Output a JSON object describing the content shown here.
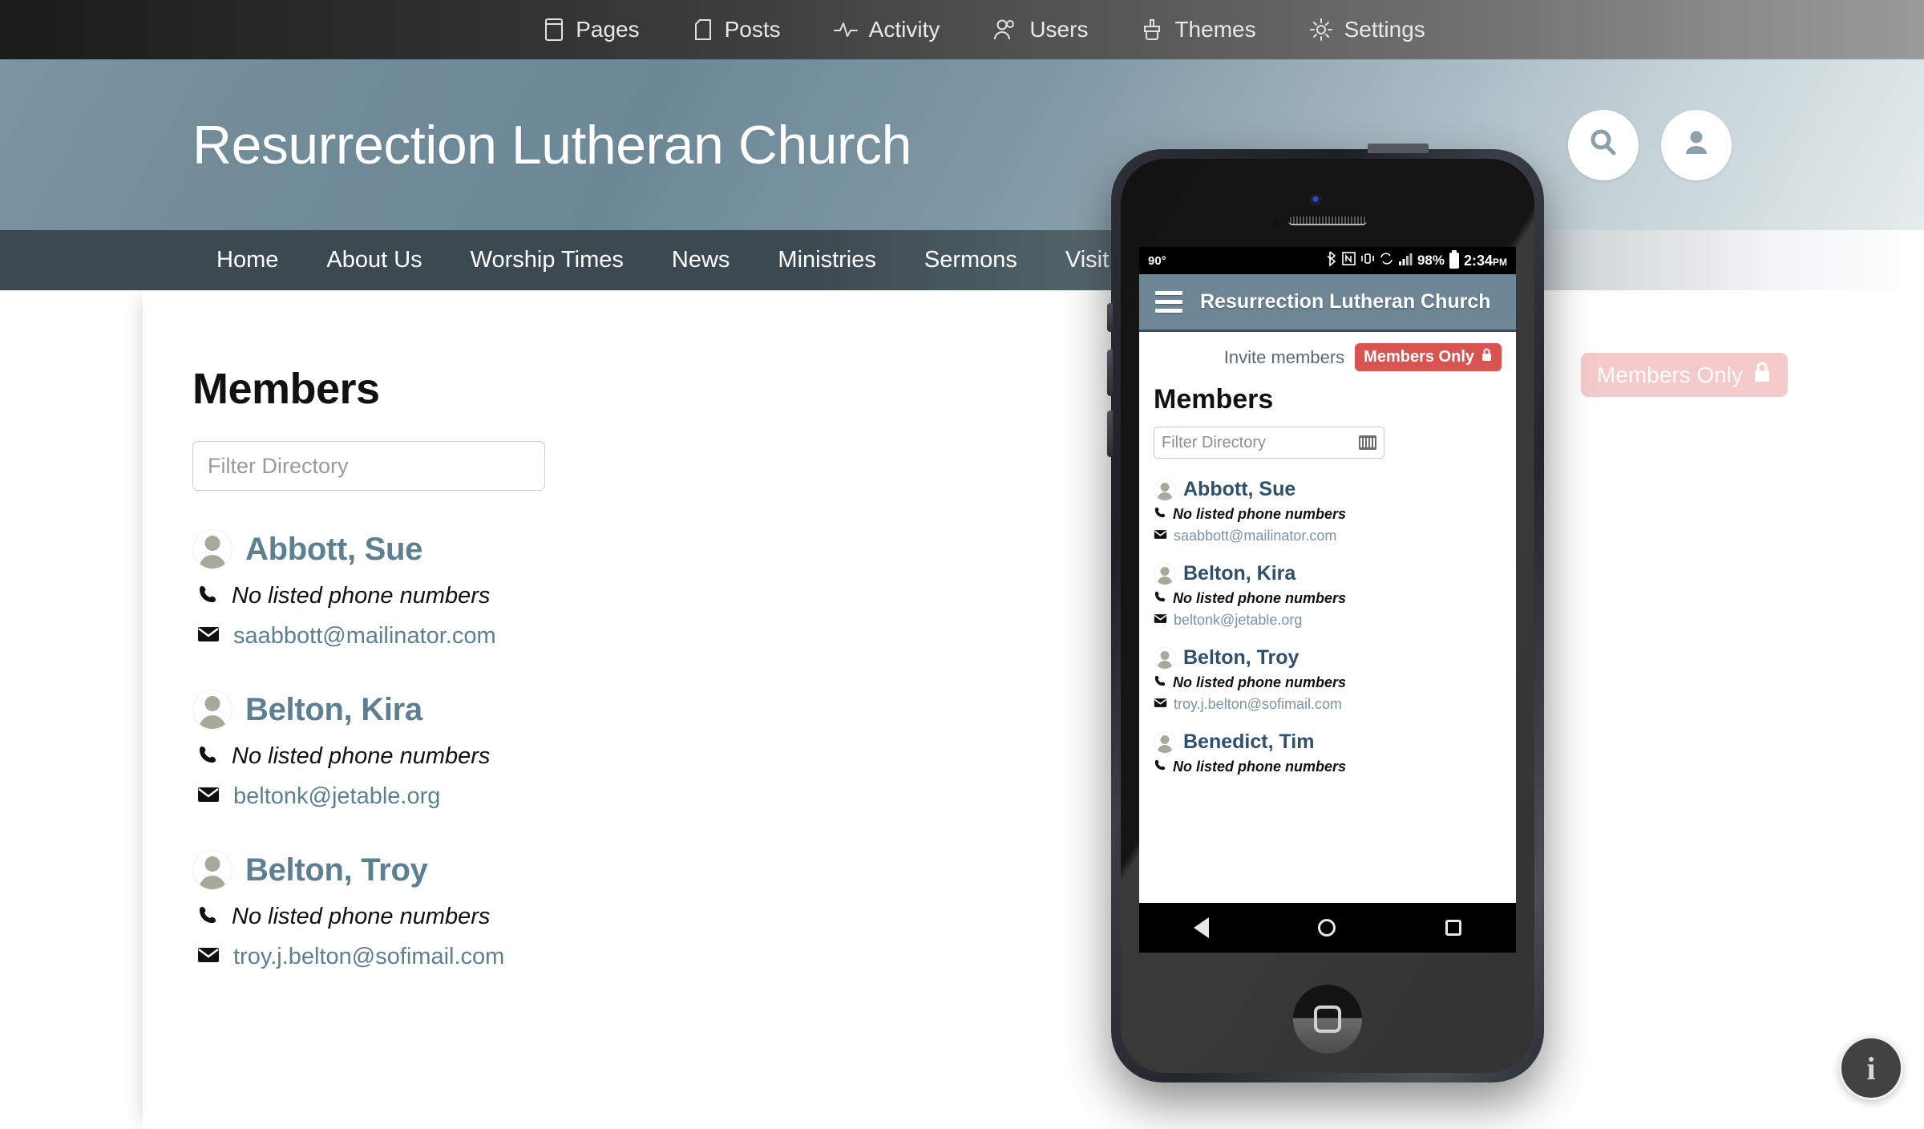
{
  "adminbar": {
    "items": [
      {
        "label": "Pages",
        "icon": "pages-icon"
      },
      {
        "label": "Posts",
        "icon": "posts-icon"
      },
      {
        "label": "Activity",
        "icon": "activity-icon"
      },
      {
        "label": "Users",
        "icon": "users-icon"
      },
      {
        "label": "Themes",
        "icon": "themes-icon"
      },
      {
        "label": "Settings",
        "icon": "settings-icon"
      }
    ]
  },
  "site": {
    "title": "Resurrection Lutheran Church",
    "header_actions": [
      {
        "name": "search-button",
        "icon": "search-icon"
      },
      {
        "name": "account-button",
        "icon": "user-icon"
      }
    ],
    "nav": [
      {
        "label": "Home"
      },
      {
        "label": "About Us"
      },
      {
        "label": "Worship Times"
      },
      {
        "label": "News"
      },
      {
        "label": "Ministries"
      },
      {
        "label": "Sermons"
      },
      {
        "label": "Visit"
      }
    ]
  },
  "main": {
    "heading": "Members",
    "filter_placeholder": "Filter Directory",
    "filter_value": "",
    "members_only_badge": "Members Only",
    "info_button": "i",
    "members": [
      {
        "name": "Abbott, Sue",
        "phone": "No listed phone numbers",
        "email": "saabbott@mailinator.com"
      },
      {
        "name": "Belton, Kira",
        "phone": "No listed phone numbers",
        "email": "beltonk@jetable.org"
      },
      {
        "name": "Belton, Troy",
        "phone": "No listed phone numbers",
        "email": "troy.j.belton@sofimail.com"
      }
    ]
  },
  "phone": {
    "status": {
      "temperature": "90°",
      "battery_percent": "98%",
      "time": "2:34",
      "meridiem": "PM"
    },
    "appbar_title": "Resurrection Lutheran Church",
    "invite_link": "Invite members",
    "members_only_badge": "Members Only",
    "heading": "Members",
    "filter_placeholder": "Filter Directory",
    "members": [
      {
        "name": "Abbott, Sue",
        "phone": "No listed phone numbers",
        "email": "saabbott@mailinator.com"
      },
      {
        "name": "Belton, Kira",
        "phone": "No listed phone numbers",
        "email": "beltonk@jetable.org"
      },
      {
        "name": "Belton, Troy",
        "phone": "No listed phone numbers",
        "email": "troy.j.belton@sofimail.com"
      },
      {
        "name": "Benedict, Tim",
        "phone": "No listed phone numbers",
        "email": ""
      }
    ]
  },
  "colors": {
    "header_blue": "#6d8796",
    "nav_dark": "#3b4a50",
    "member_name": "#5c7f91",
    "badge_red": "#d9534f"
  }
}
